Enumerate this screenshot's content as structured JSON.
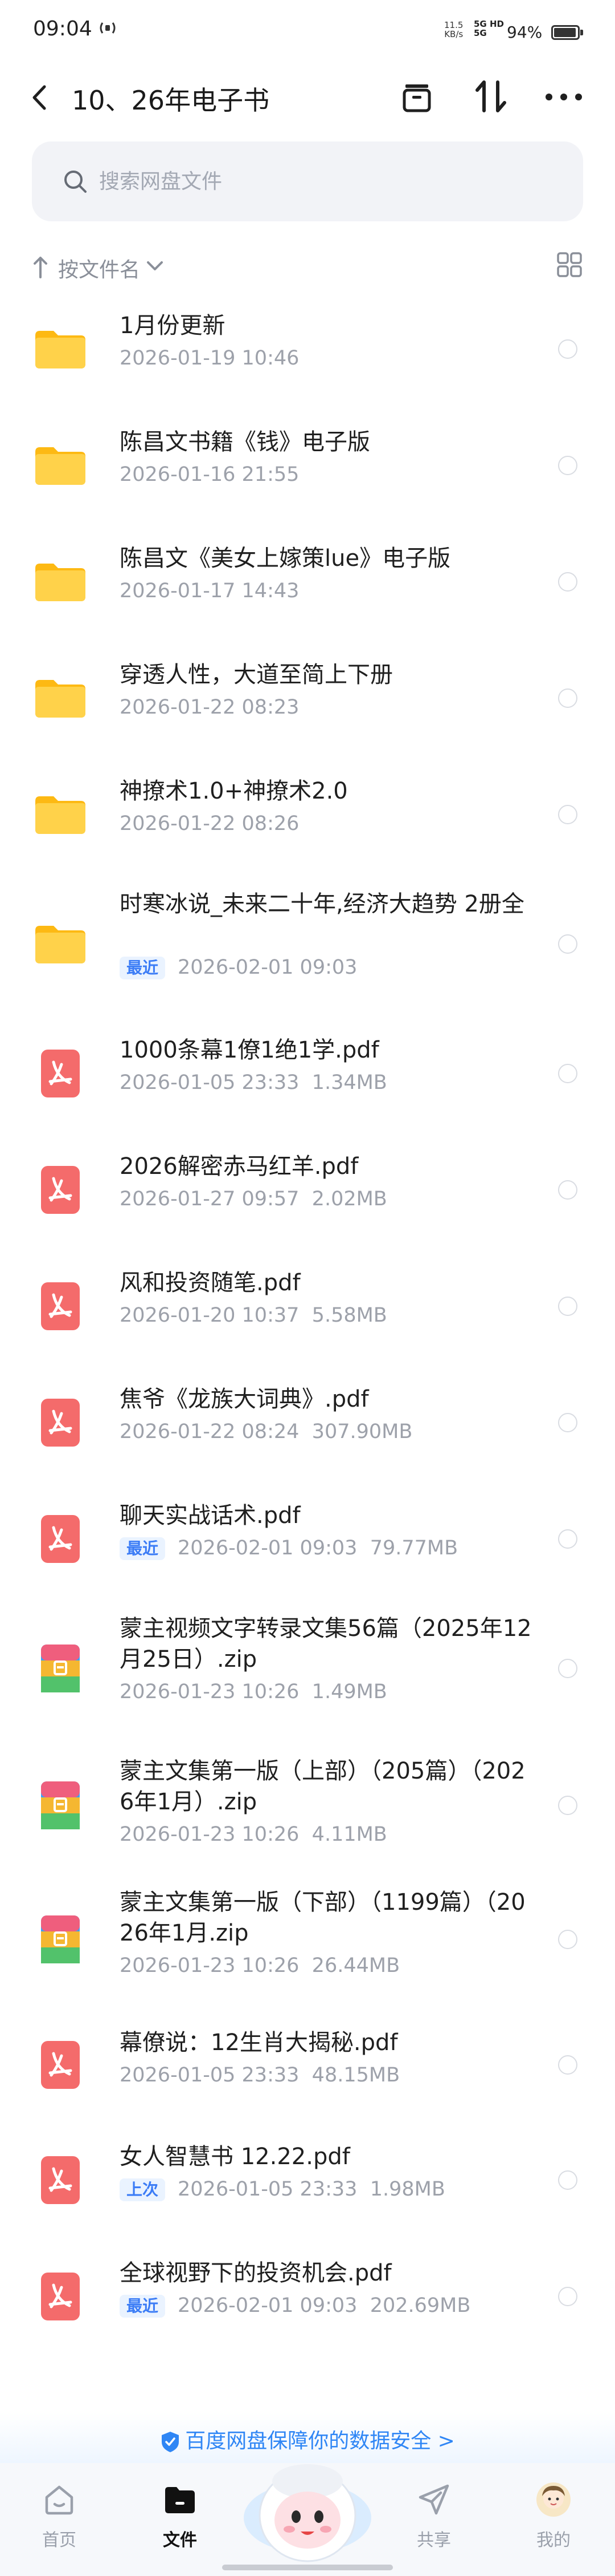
{
  "status_bar": {
    "time": "09:04",
    "speed_top": "11.5",
    "speed_bottom": "KB/s",
    "network_top": "5G HD",
    "network_bottom": "5G",
    "battery": "94%"
  },
  "header": {
    "title": "10、26年电子书"
  },
  "search": {
    "placeholder": "搜索网盘文件"
  },
  "sort": {
    "label": "按文件名"
  },
  "files": [
    {
      "type": "folder",
      "name": "1月份更新",
      "tag": "",
      "date": "2026-01-19  10:46",
      "size": ""
    },
    {
      "type": "folder",
      "name": "陈昌文书籍《钱》电子版",
      "tag": "",
      "date": "2026-01-16  21:55",
      "size": ""
    },
    {
      "type": "folder",
      "name": "陈昌文《美女上嫁策lue》电子版",
      "tag": "",
      "date": "2026-01-17  14:43",
      "size": ""
    },
    {
      "type": "folder",
      "name": "穿透人性，大道至简上下册",
      "tag": "",
      "date": "2026-01-22  08:23",
      "size": ""
    },
    {
      "type": "folder",
      "name": "神撩术1.0+神撩术2.0",
      "tag": "",
      "date": "2026-01-22  08:26",
      "size": ""
    },
    {
      "type": "folder",
      "name": "时寒冰说_未来二十年,经济大趋势 2册全",
      "tag": "最近",
      "date": "2026-02-01  09:03",
      "size": ""
    },
    {
      "type": "pdf",
      "name": "1000条幕1僚1绝1学.pdf",
      "tag": "",
      "date": "2026-01-05  23:33",
      "size": "1.34MB"
    },
    {
      "type": "pdf",
      "name": "2026解密赤马红羊.pdf",
      "tag": "",
      "date": "2026-01-27  09:57",
      "size": "2.02MB"
    },
    {
      "type": "pdf",
      "name": "风和投资随笔.pdf",
      "tag": "",
      "date": "2026-01-20  10:37",
      "size": "5.58MB"
    },
    {
      "type": "pdf",
      "name": "焦爷《龙族大词典》.pdf",
      "tag": "",
      "date": "2026-01-22  08:24",
      "size": "307.90MB"
    },
    {
      "type": "pdf",
      "name": "聊天实战话术.pdf",
      "tag": "最近",
      "date": "2026-02-01  09:03",
      "size": "79.77MB"
    },
    {
      "type": "zip",
      "name": "蒙主视频文字转录文集56篇（2025年12月25日）.zip",
      "tag": "",
      "date": "2026-01-23  10:26",
      "size": "1.49MB"
    },
    {
      "type": "zip",
      "name": "蒙主文集第一版（上部）（205篇）（2026年1月）.zip",
      "tag": "",
      "date": "2026-01-23  10:26",
      "size": "4.11MB"
    },
    {
      "type": "zip",
      "name": "蒙主文集第一版（下部）（1199篇）（2026年1月.zip",
      "tag": "",
      "date": "2026-01-23  10:26",
      "size": "26.44MB"
    },
    {
      "type": "pdf",
      "name": "幕僚说：12生肖大揭秘.pdf",
      "tag": "",
      "date": "2026-01-05  23:33",
      "size": "48.15MB"
    },
    {
      "type": "pdf",
      "name": "女人智慧书 12.22.pdf",
      "tag": "上次",
      "date": "2026-01-05  23:33",
      "size": "1.98MB"
    },
    {
      "type": "pdf",
      "name": "全球视野下的投资机会.pdf",
      "tag": "最近",
      "date": "2026-02-01  09:03",
      "size": "202.69MB"
    }
  ],
  "banner": {
    "text": "百度网盘保障你的数据安全 >"
  },
  "nav": {
    "items": [
      {
        "label": "首页",
        "icon": "home-icon",
        "active": false
      },
      {
        "label": "文件",
        "icon": "folder-icon",
        "active": true
      },
      {
        "label": "共享",
        "icon": "send-icon",
        "active": false
      },
      {
        "label": "我的",
        "icon": "avatar-icon",
        "active": false
      }
    ]
  },
  "colors": {
    "accent": "#3b7cf6",
    "folder": "#ffcd3a",
    "pdf": "#f36a6a",
    "text_secondary": "#9da1aa"
  }
}
